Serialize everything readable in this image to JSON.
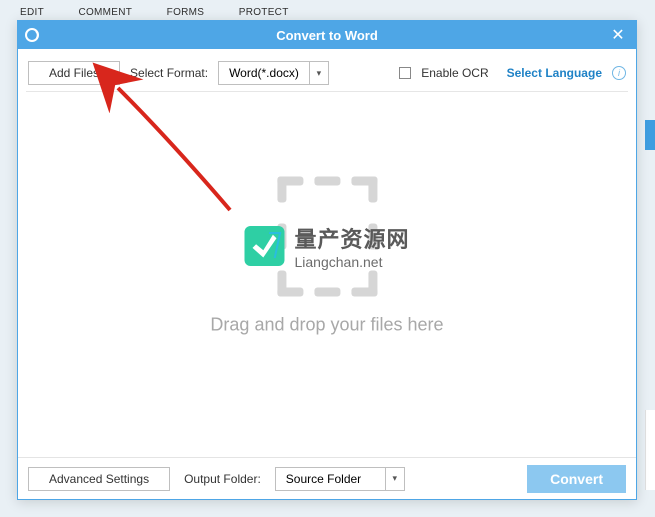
{
  "colors": {
    "accent": "#4ea6e6",
    "link": "#1f82c6",
    "convert_btn": "#8cc8f0",
    "arrow": "#d8261c"
  },
  "bg_menu": {
    "items": [
      "EDIT",
      "COMMENT",
      "FORMS",
      "PROTECT"
    ]
  },
  "titlebar": {
    "title": "Convert to Word",
    "close_glyph": "✕"
  },
  "toolbar": {
    "add_files_label": "Add Files",
    "format_label": "Select Format:",
    "format_value": "Word(*.docx)",
    "enable_ocr_label": "Enable OCR",
    "enable_ocr_checked": false,
    "select_language_label": "Select Language",
    "info_glyph": "i"
  },
  "drop_area": {
    "hint": "Drag and drop your files here"
  },
  "watermark": {
    "cn_text": "量产资源网",
    "url_text": "Liangchan.net"
  },
  "bottombar": {
    "advanced_label": "Advanced Settings",
    "output_folder_label": "Output Folder:",
    "output_folder_value": "Source Folder",
    "convert_label": "Convert"
  },
  "chevron_glyph": "▾"
}
